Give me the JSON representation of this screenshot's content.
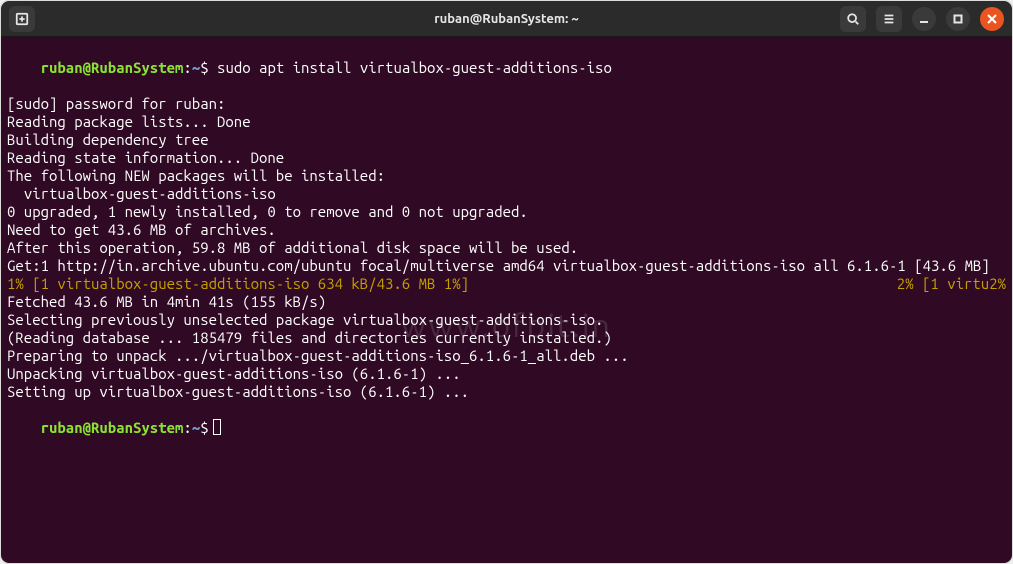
{
  "titlebar": {
    "title": "ruban@RubanSystem: ~"
  },
  "prompt1": {
    "userhost": "ruban@RubanSystem",
    "sep": ":",
    "path": "~",
    "dollar": "$",
    "command": "sudo apt install virtualbox-guest-additions-iso"
  },
  "output": {
    "l1": "[sudo] password for ruban:",
    "l2": "Reading package lists... Done",
    "l3": "Building dependency tree",
    "l4": "Reading state information... Done",
    "l5": "The following NEW packages will be installed:",
    "l6": "  virtualbox-guest-additions-iso",
    "l7": "0 upgraded, 1 newly installed, 0 to remove and 0 not upgraded.",
    "l8": "Need to get 43.6 MB of archives.",
    "l9": "After this operation, 59.8 MB of additional disk space will be used.",
    "l10": "Get:1 http://in.archive.ubuntu.com/ubuntu focal/multiverse amd64 virtualbox-guest-additions-iso all 6.1.6-1 [43.6 MB]",
    "progress_left": "1% [1 virtualbox-guest-additions-iso 634 kB/43.6 MB 1%]",
    "progress_right": "2% [1 virtu2%",
    "l12": "Fetched 43.6 MB in 4min 41s (155 kB/s)",
    "l13": "Selecting previously unselected package virtualbox-guest-additions-iso.",
    "l14": "(Reading database ... 185479 files and directories currently installed.)",
    "l15": "Preparing to unpack .../virtualbox-guest-additions-iso_6.1.6-1_all.deb ...",
    "l16": "Unpacking virtualbox-guest-additions-iso (6.1.6-1) ...",
    "l17": "Setting up virtualbox-guest-additions-iso (6.1.6-1) ..."
  },
  "prompt2": {
    "userhost": "ruban@RubanSystem",
    "sep": ":",
    "path": "~",
    "dollar": "$"
  },
  "watermark": "www.ofbit.in"
}
